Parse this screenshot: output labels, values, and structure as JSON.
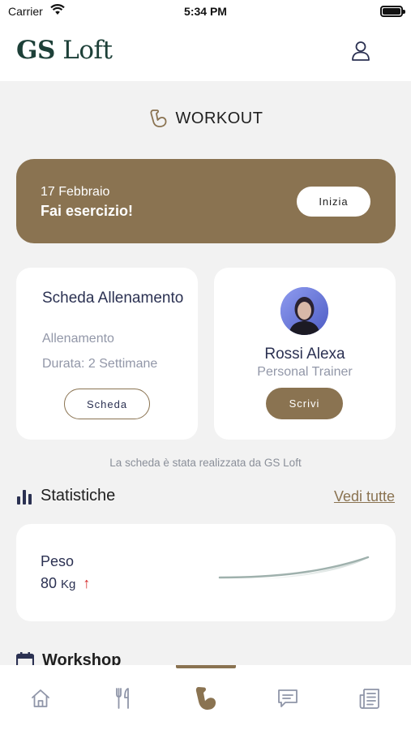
{
  "status_bar": {
    "carrier": "Carrier",
    "time": "5:34 PM"
  },
  "header": {
    "logo_bold": "GS",
    "logo_light": "Loft",
    "profile_icon": "user-icon"
  },
  "workout": {
    "title": "WORKOUT",
    "icon": "flexed-arm-icon"
  },
  "banner": {
    "date": "17 Febbraio",
    "message": "Fai esercizio!",
    "button": "Inizia"
  },
  "plan_card": {
    "title": "Scheda Allenamento",
    "subtitle": "Allenamento",
    "duration": "Durata: 2 Settimane",
    "button": "Scheda"
  },
  "trainer_card": {
    "name": "Rossi Alexa",
    "role": "Personal Trainer",
    "button": "Scrivi"
  },
  "credit": "La scheda è stata realizzata da GS Loft",
  "stats": {
    "title": "Statistiche",
    "see_all": "Vedi tutte",
    "weight": {
      "label": "Peso",
      "value": "80",
      "unit": "Kg",
      "trend": "up",
      "trend_color": "#d42a2a"
    }
  },
  "workshop": {
    "title": "Workshop"
  },
  "tabbar": {
    "active": "workout",
    "tabs": [
      {
        "id": "home",
        "icon": "home-icon"
      },
      {
        "id": "nutrition",
        "icon": "fork-knife-icon"
      },
      {
        "id": "workout",
        "icon": "flexed-arm-icon"
      },
      {
        "id": "messages",
        "icon": "chat-icon"
      },
      {
        "id": "news",
        "icon": "newspaper-icon"
      }
    ]
  },
  "colors": {
    "accent": "#8a7351",
    "logo": "#1d4038",
    "navy_text": "#2b3152",
    "muted_text": "#9297a8",
    "background": "#f2f2f2"
  }
}
